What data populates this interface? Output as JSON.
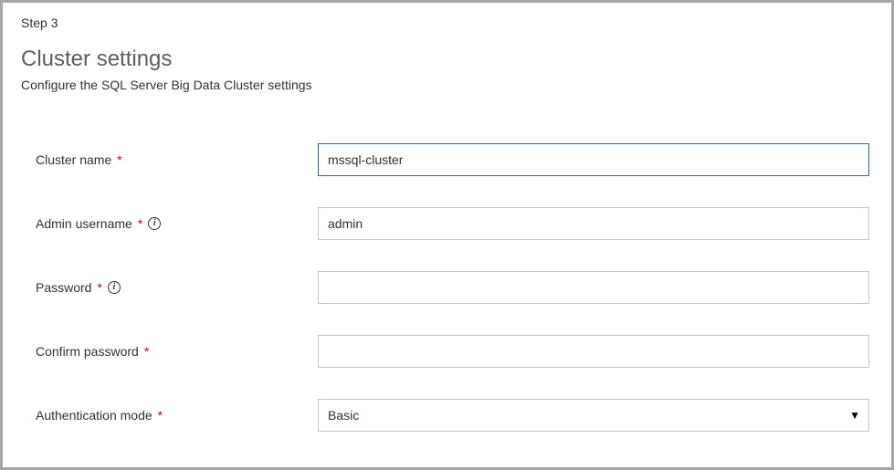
{
  "step": "Step 3",
  "title": "Cluster settings",
  "subtitle": "Configure the SQL Server Big Data Cluster settings",
  "fields": {
    "clusterName": {
      "label": "Cluster name",
      "value": "mssql-cluster",
      "required": true
    },
    "adminUsername": {
      "label": "Admin username",
      "value": "admin",
      "required": true,
      "info": true
    },
    "password": {
      "label": "Password",
      "value": "",
      "required": true,
      "info": true
    },
    "confirmPassword": {
      "label": "Confirm password",
      "value": "",
      "required": true
    },
    "authMode": {
      "label": "Authentication mode",
      "value": "Basic",
      "required": true
    }
  }
}
